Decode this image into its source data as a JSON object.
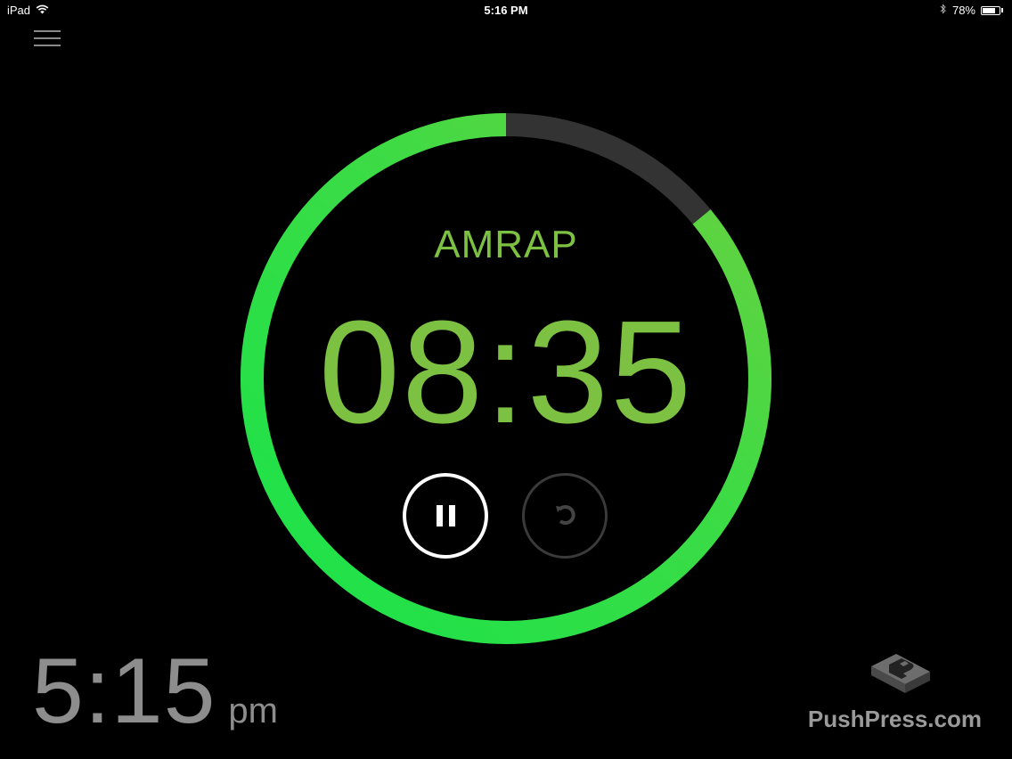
{
  "status_bar": {
    "device": "iPad",
    "time": "5:16 PM",
    "battery": "78%",
    "battery_level": 0.78
  },
  "timer": {
    "mode": "AMRAP",
    "time": "08:35",
    "progress_remaining": 0.86
  },
  "controls": {
    "pause": "pause-icon",
    "reset": "reset-icon"
  },
  "clock": {
    "time": "5:15",
    "ampm": "pm"
  },
  "brand": {
    "name": "PushPress.com"
  },
  "colors": {
    "background": "#000000",
    "ring_green": "#19e34a",
    "ring_green_end": "#6fcf3f",
    "ring_track": "#333333",
    "text_green": "#7dc142",
    "clock_gray": "#8d8d8d"
  }
}
